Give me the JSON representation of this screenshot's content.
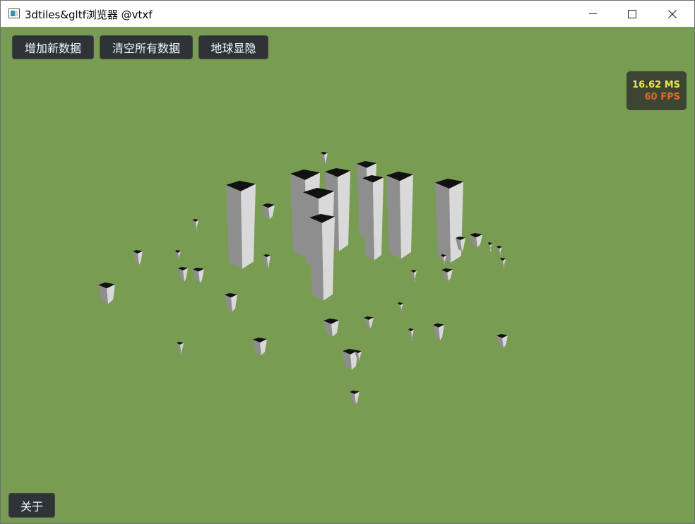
{
  "window": {
    "title": "3dtiles&gltf浏览器 @vtxf",
    "controls": [
      "minimize-icon",
      "maximize-icon",
      "close-icon"
    ]
  },
  "toolbar": {
    "add_label": "增加新数据",
    "clear_label": "清空所有数据",
    "globe_label": "地球显隐"
  },
  "footer": {
    "about_label": "关于"
  },
  "performance": {
    "ms_text": "16.62 MS",
    "fps_text": "60 FPS",
    "ms_color": "#e8e84a",
    "fps_color": "#e8662a"
  },
  "scene": {
    "background_color": "#789c51",
    "building_top_color": "#111111",
    "building_light_color": "#d9d9d9",
    "building_dark_color": "#8e8e8e"
  }
}
